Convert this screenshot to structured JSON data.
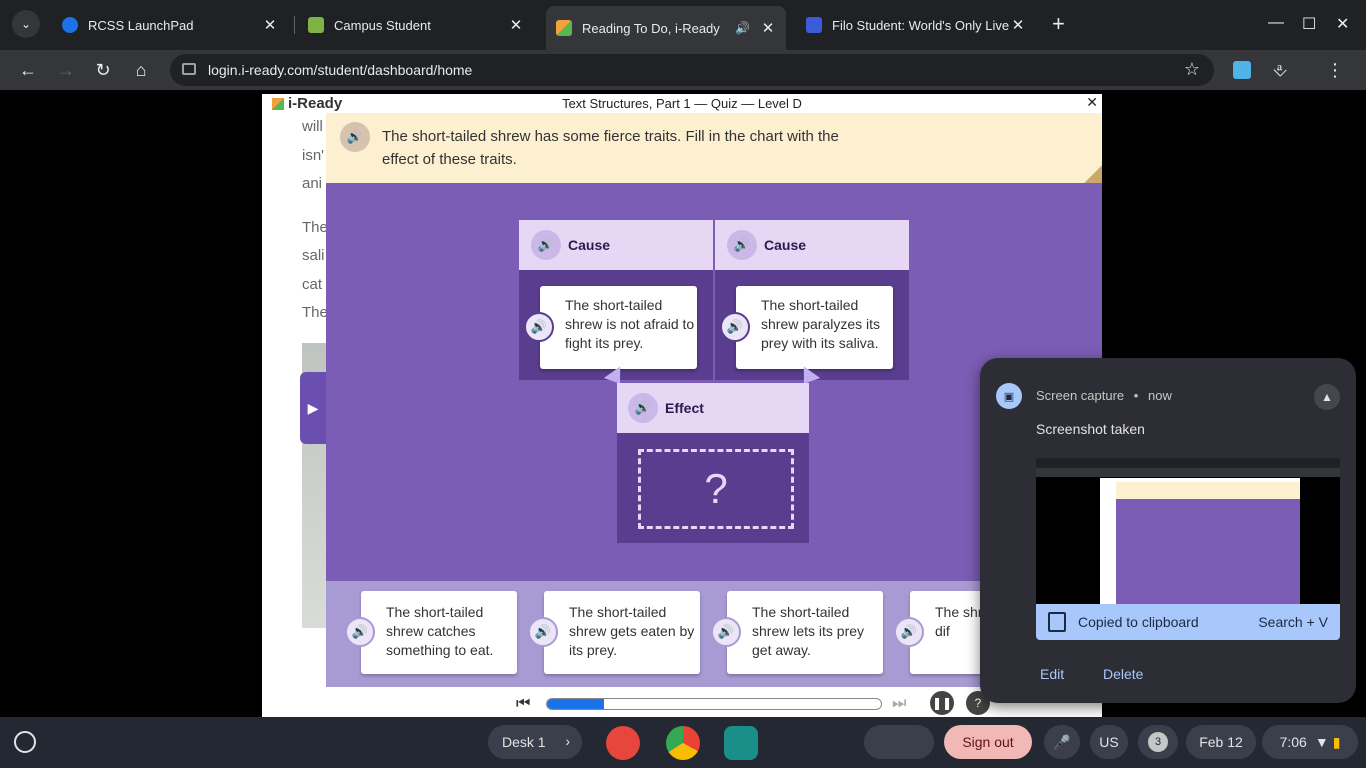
{
  "browser": {
    "tabs": [
      {
        "title": "RCSS LaunchPad",
        "favicon_color": "#1a73e8"
      },
      {
        "title": "Campus Student",
        "favicon_color": "#7cb342"
      },
      {
        "title": "Reading To Do, i-Ready",
        "favicon_color": "#f2a23c",
        "active": true
      },
      {
        "title": "Filo Student: World's Only Live I",
        "favicon_color": "#3b5bdb"
      }
    ],
    "url": "login.i-ready.com/student/dashboard/home"
  },
  "article": {
    "lines": [
      "will",
      "isn'",
      "ani",
      "The",
      "sali",
      "cat",
      "The"
    ]
  },
  "quiz": {
    "logo": "i-Ready",
    "title": "Text Structures, Part 1 — Quiz — Level D",
    "close": "✕",
    "prompt": "The short-tailed shrew has some fierce traits. Fill in the chart with the effect of these traits.",
    "causes": [
      {
        "label": "Cause",
        "text": "The short-tailed shrew is not afraid to fight its prey."
      },
      {
        "label": "Cause",
        "text": "The short-tailed shrew paralyzes its prey with its saliva."
      }
    ],
    "effect": {
      "label": "Effect",
      "placeholder": "?"
    },
    "answer_choices": [
      "The short-tailed shrew catches something to eat.",
      "The short-tailed shrew gets eaten by its prey.",
      "The short-tailed shrew lets its prey get away.",
      "The shr shrew find dif"
    ],
    "progress_fraction": 0.17
  },
  "notification": {
    "app": "Screen capture",
    "time": "now",
    "separator": "•",
    "title": "Screenshot taken",
    "clipboard_label": "Copied to clipboard",
    "shortcut": "Search + V",
    "actions": {
      "edit": "Edit",
      "delete": "Delete"
    }
  },
  "shelf": {
    "desk": "Desk 1",
    "sign_out": "Sign out",
    "keyboard_layout": "US",
    "notification_count": "3",
    "date": "Feb 12",
    "time": "7:06"
  },
  "colors": {
    "stage_purple": "#7b5db5",
    "column_purple": "#5a3d8f",
    "header_lavender": "#e6d7f5",
    "banner_cream": "#fdf0d0",
    "progress_blue": "#1a73e8"
  }
}
